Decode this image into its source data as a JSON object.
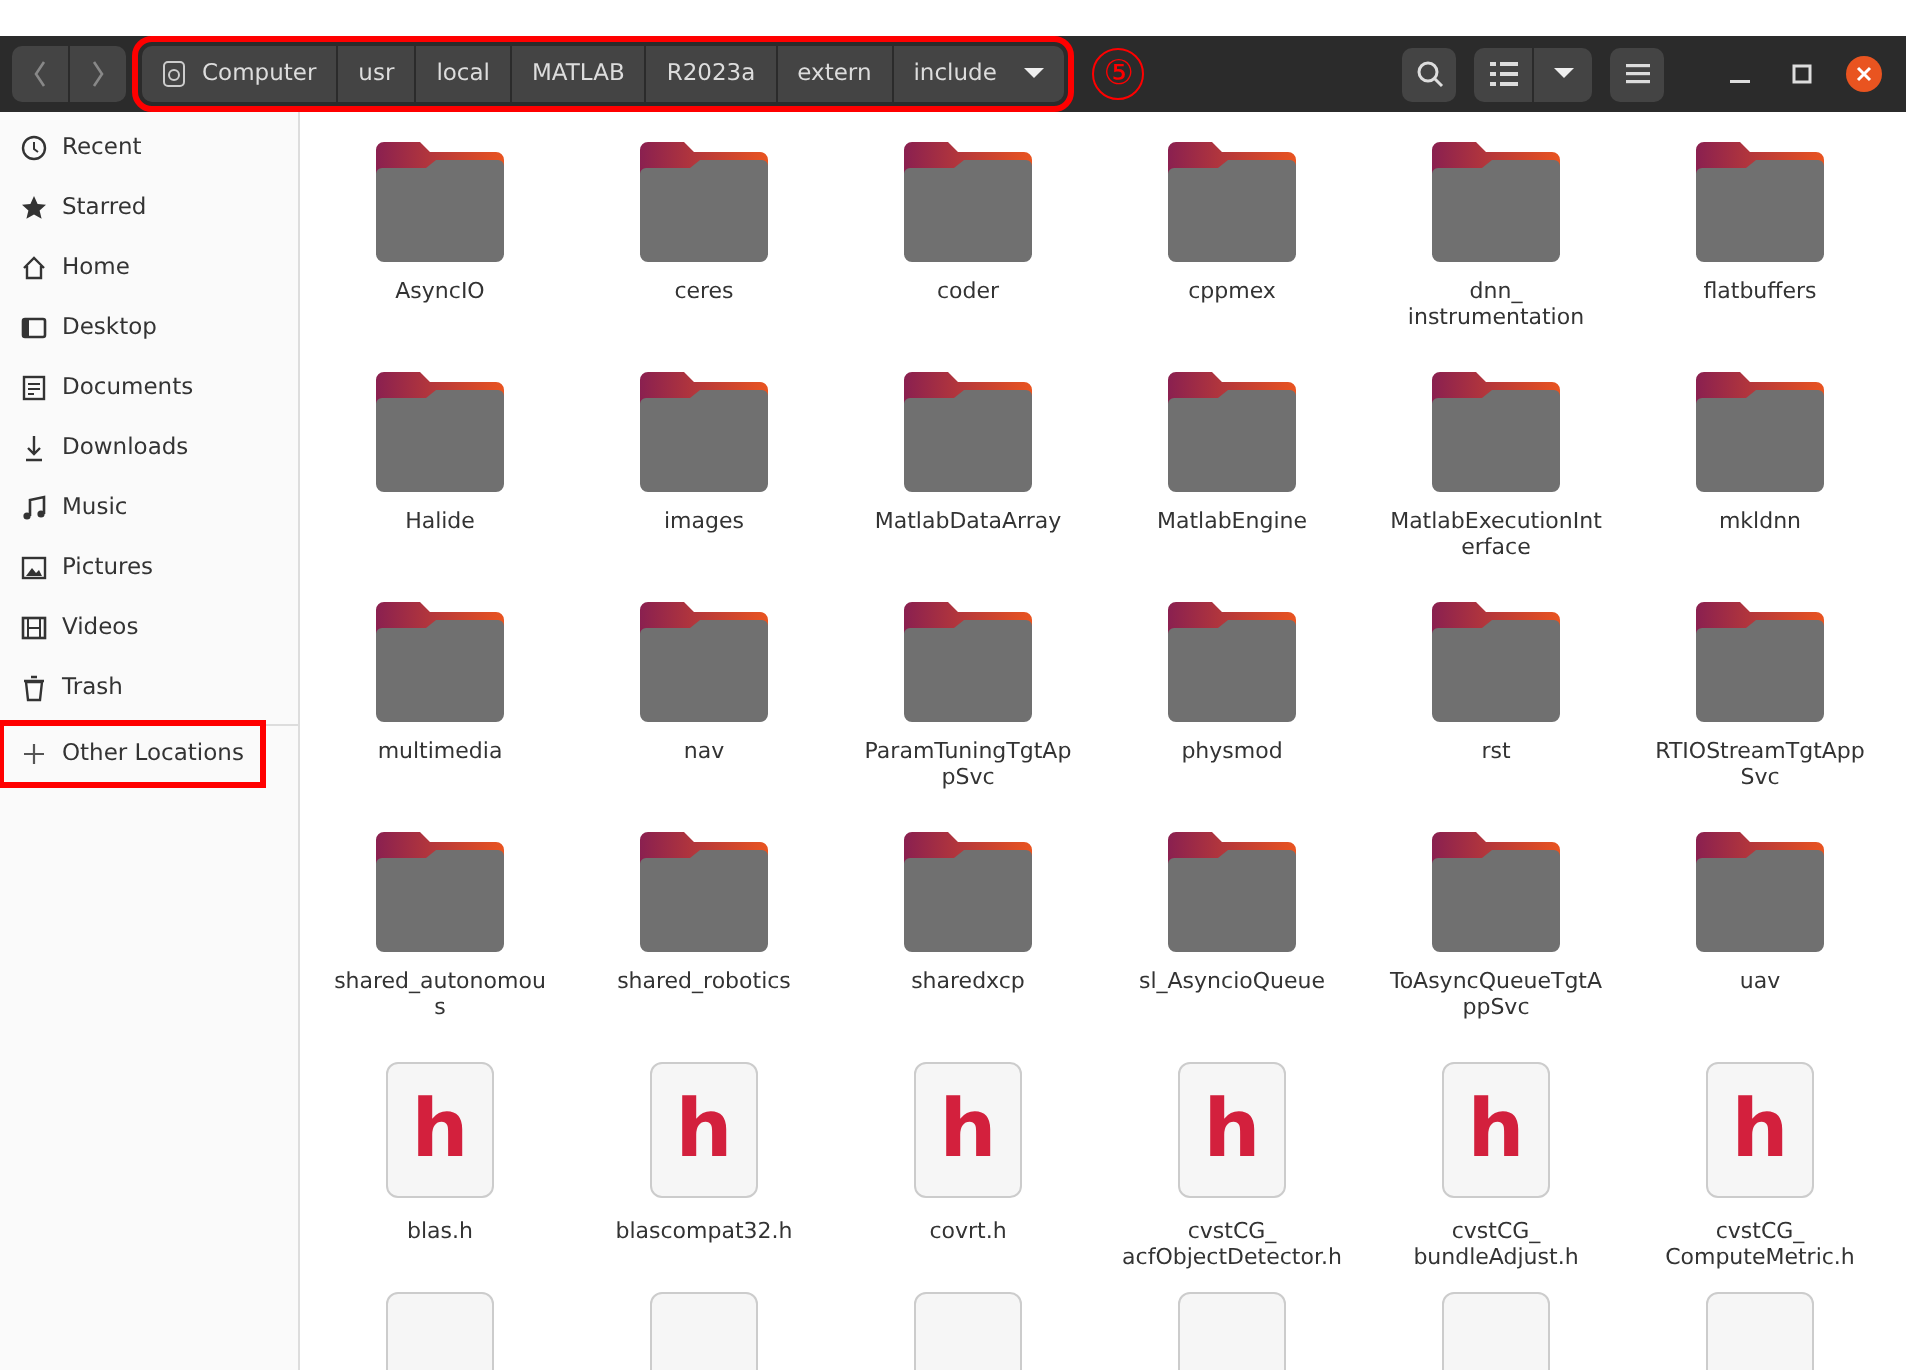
{
  "header": {
    "back_enabled": false,
    "forward_enabled": false,
    "path": [
      {
        "label": "Computer",
        "kind": "root"
      },
      {
        "label": "usr",
        "kind": "dir"
      },
      {
        "label": "local",
        "kind": "dir"
      },
      {
        "label": "MATLAB",
        "kind": "dir"
      },
      {
        "label": "R2023a",
        "kind": "dir"
      },
      {
        "label": "extern",
        "kind": "dir"
      },
      {
        "label": "include",
        "kind": "current"
      }
    ],
    "path_highlighted": true,
    "callout": "⑤"
  },
  "sidebar": {
    "items": [
      {
        "label": "Recent"
      },
      {
        "label": "Starred"
      },
      {
        "label": "Home"
      },
      {
        "label": "Desktop"
      },
      {
        "label": "Documents"
      },
      {
        "label": "Downloads"
      },
      {
        "label": "Music"
      },
      {
        "label": "Pictures"
      },
      {
        "label": "Videos"
      },
      {
        "label": "Trash"
      }
    ],
    "other": {
      "label": "Other Locations",
      "highlighted": true
    }
  },
  "items": [
    {
      "kind": "folder",
      "name": "AsyncIO"
    },
    {
      "kind": "folder",
      "name": "ceres"
    },
    {
      "kind": "folder",
      "name": "coder"
    },
    {
      "kind": "folder",
      "name": "cppmex"
    },
    {
      "kind": "folder",
      "name": "dnn_ instrumentation"
    },
    {
      "kind": "folder",
      "name": "flatbuffers"
    },
    {
      "kind": "folder",
      "name": "Halide"
    },
    {
      "kind": "folder",
      "name": "images"
    },
    {
      "kind": "folder",
      "name": "MatlabDataArray"
    },
    {
      "kind": "folder",
      "name": "MatlabEngine"
    },
    {
      "kind": "folder",
      "name": "MatlabExecutionInterface"
    },
    {
      "kind": "folder",
      "name": "mkldnn"
    },
    {
      "kind": "folder",
      "name": "multimedia"
    },
    {
      "kind": "folder",
      "name": "nav"
    },
    {
      "kind": "folder",
      "name": "ParamTuningTgtAppSvc"
    },
    {
      "kind": "folder",
      "name": "physmod"
    },
    {
      "kind": "folder",
      "name": "rst"
    },
    {
      "kind": "folder",
      "name": "RTIOStreamTgtAppSvc"
    },
    {
      "kind": "folder",
      "name": "shared_autonomous"
    },
    {
      "kind": "folder",
      "name": "shared_robotics"
    },
    {
      "kind": "folder",
      "name": "sharedxcp"
    },
    {
      "kind": "folder",
      "name": "sl_AsyncioQueue"
    },
    {
      "kind": "folder",
      "name": "ToAsyncQueueTgtAppSvc"
    },
    {
      "kind": "folder",
      "name": "uav"
    },
    {
      "kind": "header",
      "name": "blas.h",
      "glyph": "h"
    },
    {
      "kind": "header",
      "name": "blascompat32.h",
      "glyph": "h"
    },
    {
      "kind": "header",
      "name": "covrt.h",
      "glyph": "h"
    },
    {
      "kind": "header",
      "name": "cvstCG_ acfObjectDetector.h",
      "glyph": "h"
    },
    {
      "kind": "header",
      "name": "cvstCG_ bundleAdjust.h",
      "glyph": "h"
    },
    {
      "kind": "header",
      "name": "cvstCG_ ComputeMetric.h",
      "glyph": "h"
    },
    {
      "kind": "header"
    },
    {
      "kind": "header"
    },
    {
      "kind": "header"
    },
    {
      "kind": "header"
    },
    {
      "kind": "header"
    },
    {
      "kind": "header"
    }
  ]
}
